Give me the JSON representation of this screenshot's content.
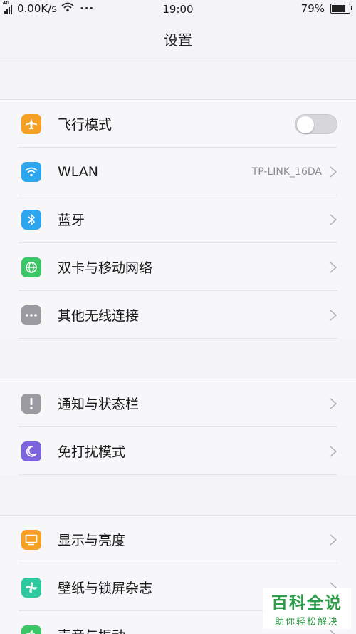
{
  "status_bar": {
    "network_tag": "4G",
    "speed": "0.00K/s",
    "more": "···",
    "time": "19:00",
    "battery_text": "79%",
    "battery_level": 0.79
  },
  "header": {
    "title": "设置"
  },
  "groups": [
    {
      "items": [
        {
          "label": "飞行模式",
          "icon": "airplane-icon",
          "icon_color": "#f5a024",
          "control": "toggle",
          "toggle_on": false
        },
        {
          "label": "WLAN",
          "icon": "wifi-icon",
          "icon_color": "#2ea5ef",
          "value": "TP-LINK_16DA"
        },
        {
          "label": "蓝牙",
          "icon": "bluetooth-icon",
          "icon_color": "#2ea5ef"
        },
        {
          "label": "双卡与移动网络",
          "icon": "globe-icon",
          "icon_color": "#3cc667"
        },
        {
          "label": "其他无线连接",
          "icon": "more-icon",
          "icon_color": "#9a9aa0"
        }
      ]
    },
    {
      "items": [
        {
          "label": "通知与状态栏",
          "icon": "exclamation-icon",
          "icon_color": "#9a9aa0"
        },
        {
          "label": "免打扰模式",
          "icon": "moon-icon",
          "icon_color": "#7b64dc"
        }
      ]
    },
    {
      "items": [
        {
          "label": "显示与亮度",
          "icon": "display-icon",
          "icon_color": "#f5a024"
        },
        {
          "label": "壁纸与锁屏杂志",
          "icon": "pinwheel-icon",
          "icon_color": "#2fc9a0"
        },
        {
          "label": "声音与振动",
          "icon": "sound-icon",
          "icon_color": "#3cc667"
        }
      ]
    }
  ],
  "watermark": {
    "title": "百科全说",
    "subtitle": "助你轻松解决"
  }
}
